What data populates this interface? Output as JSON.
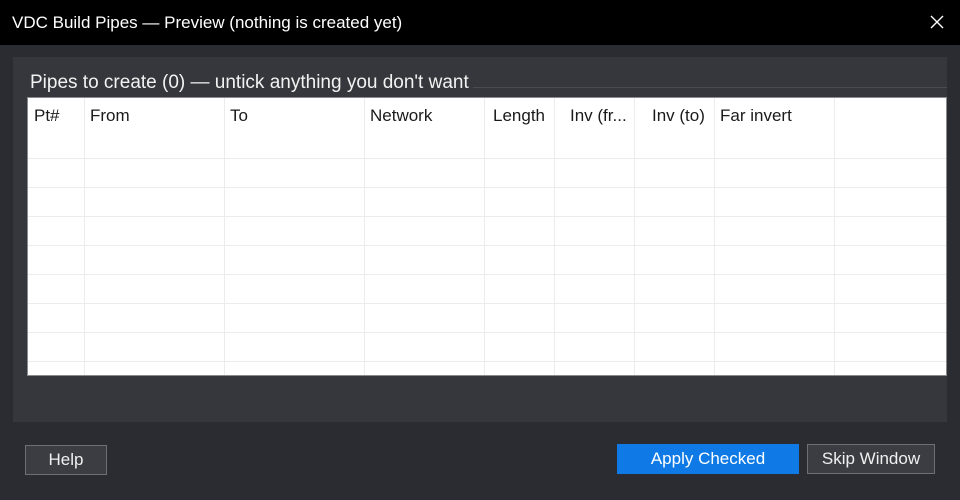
{
  "window": {
    "title": "VDC Build Pipes — Preview (nothing is created yet)"
  },
  "group": {
    "title": "Pipes to create (0) — untick anything you don't want"
  },
  "table": {
    "columns": [
      "Pt#",
      "From",
      "To",
      "Network",
      "Length",
      "Inv (fr...",
      "Inv (to)",
      "Far invert"
    ],
    "rows": []
  },
  "buttons": {
    "help": "Help",
    "apply": "Apply Checked",
    "skip": "Skip Window"
  },
  "colors": {
    "titlebar": "#000000",
    "window_bg": "#2b2c31",
    "panel_bg": "#36373c",
    "primary": "#0f7ae5"
  }
}
